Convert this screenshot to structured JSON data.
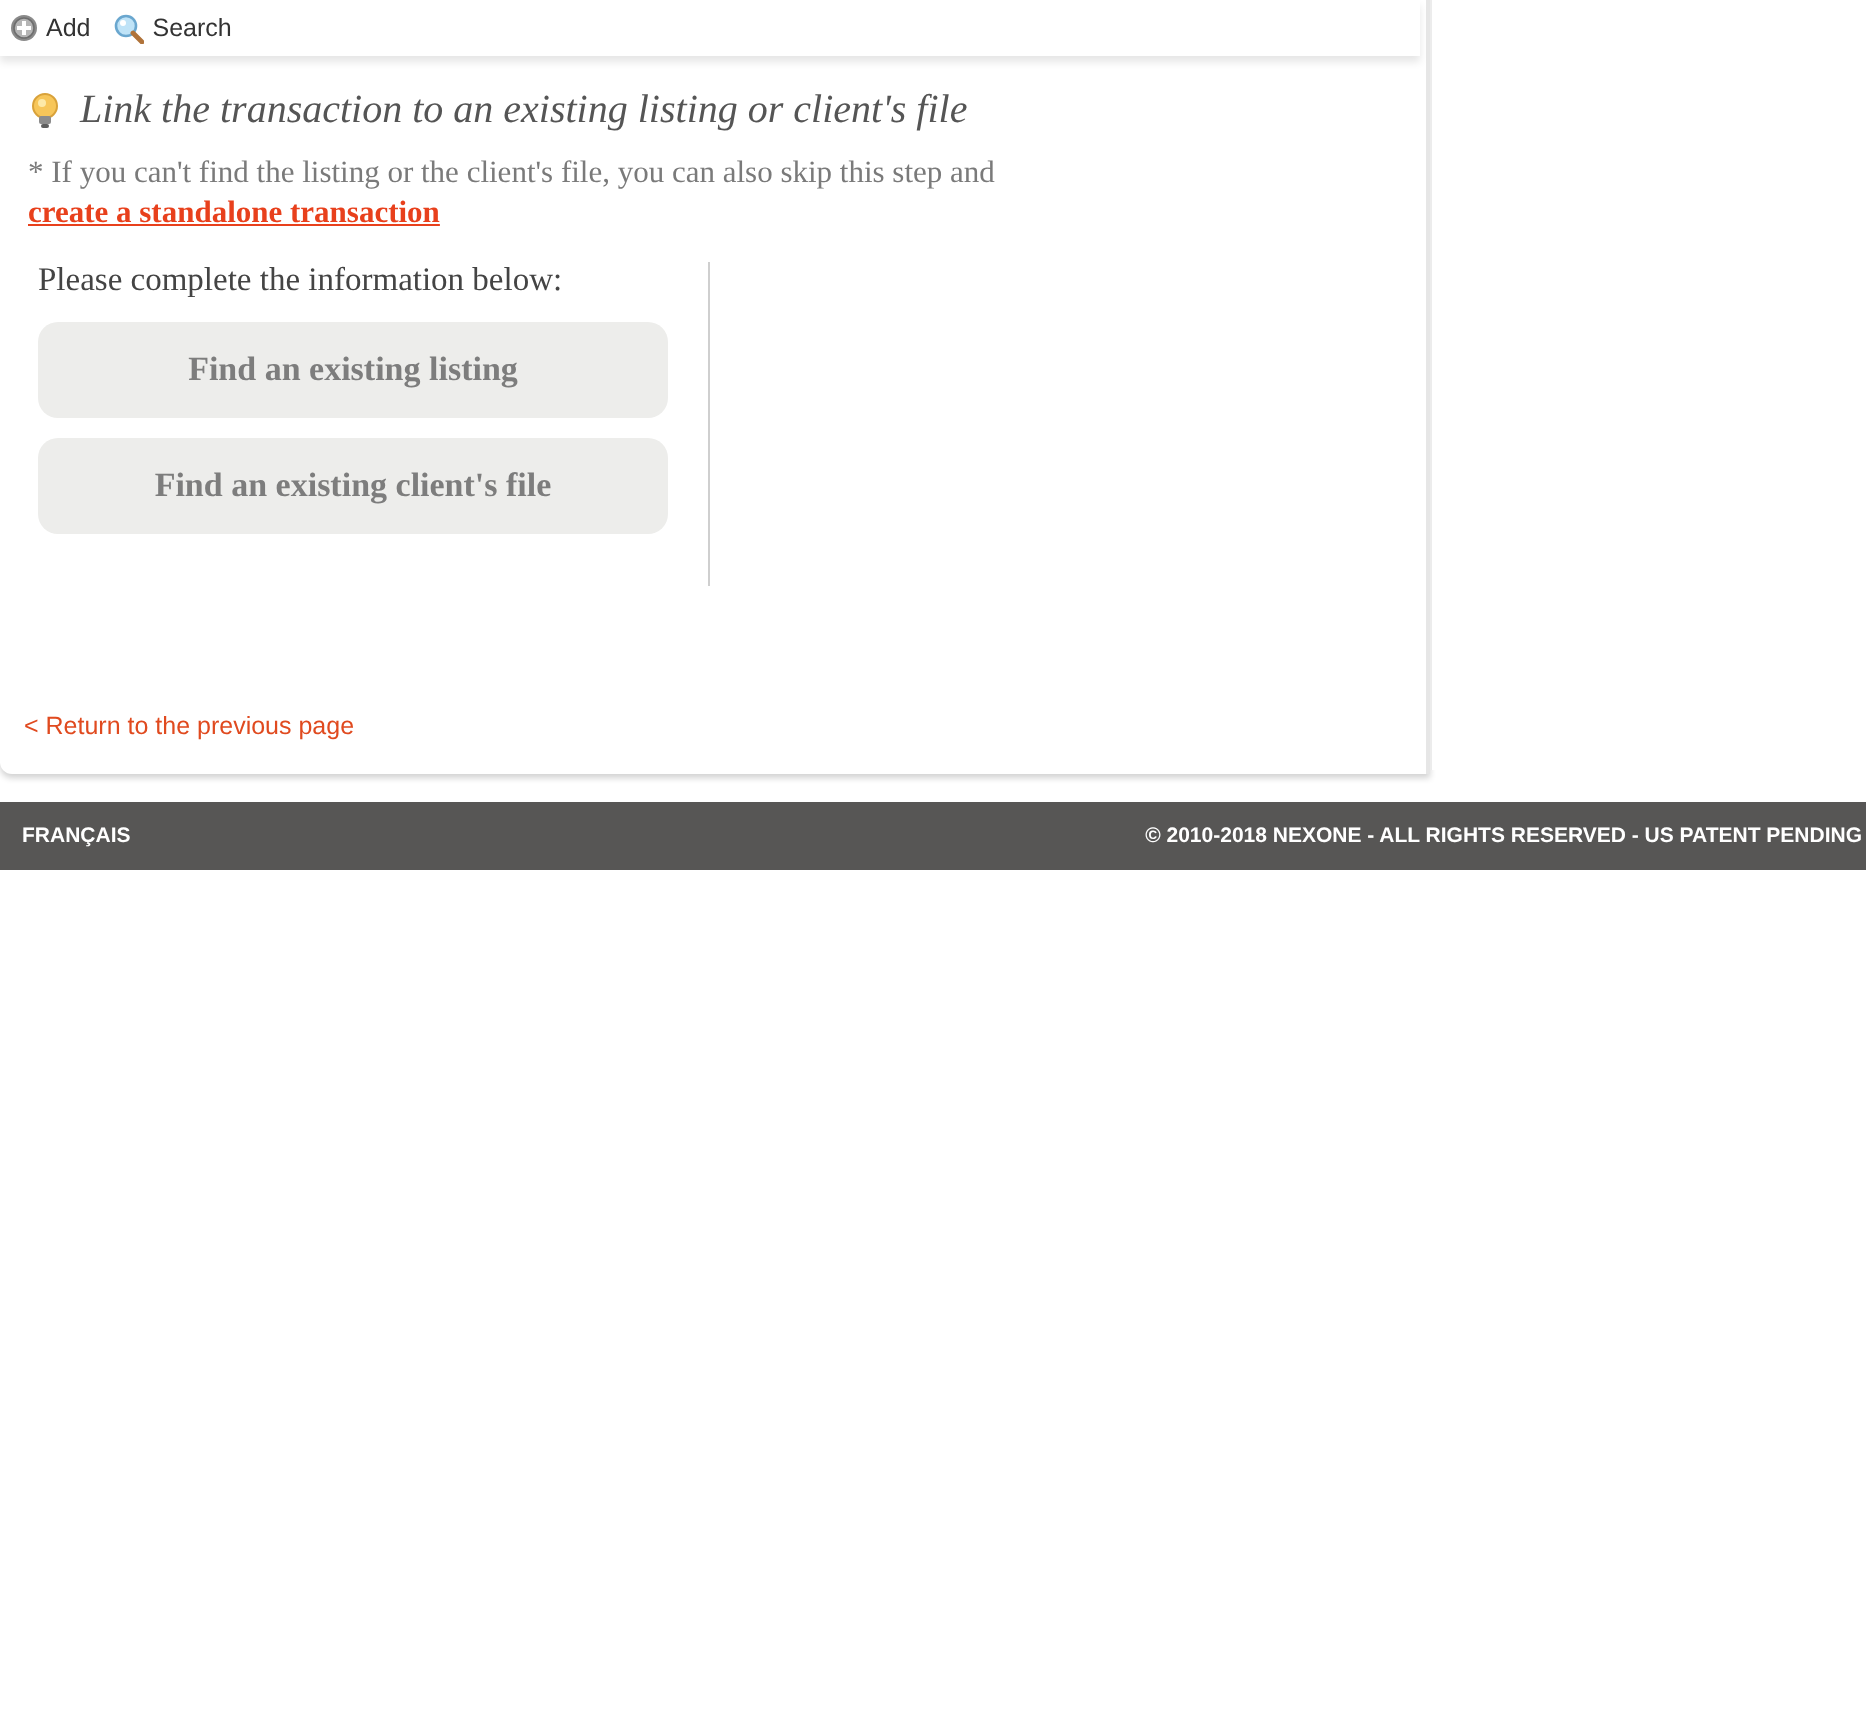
{
  "toolbar": {
    "items": [
      {
        "kind": "add",
        "label": "Add"
      },
      {
        "kind": "search",
        "label": "Search"
      }
    ]
  },
  "heading": "Link the transaction to an existing listing or client's file",
  "note": {
    "text": "* If you can't find the listing or the client's file, you can also skip this step and",
    "link": "create a standalone transaction"
  },
  "prompt": "Please complete the information below:",
  "buttons": [
    "Find an existing listing",
    "Find an existing client's file"
  ],
  "back_link": "< Return to the previous page",
  "footer": {
    "language": "FRANÇAIS",
    "copyright": "© 2010-2018 NEXONE - ALL RIGHTS RESERVED - US PATENT PENDING"
  }
}
